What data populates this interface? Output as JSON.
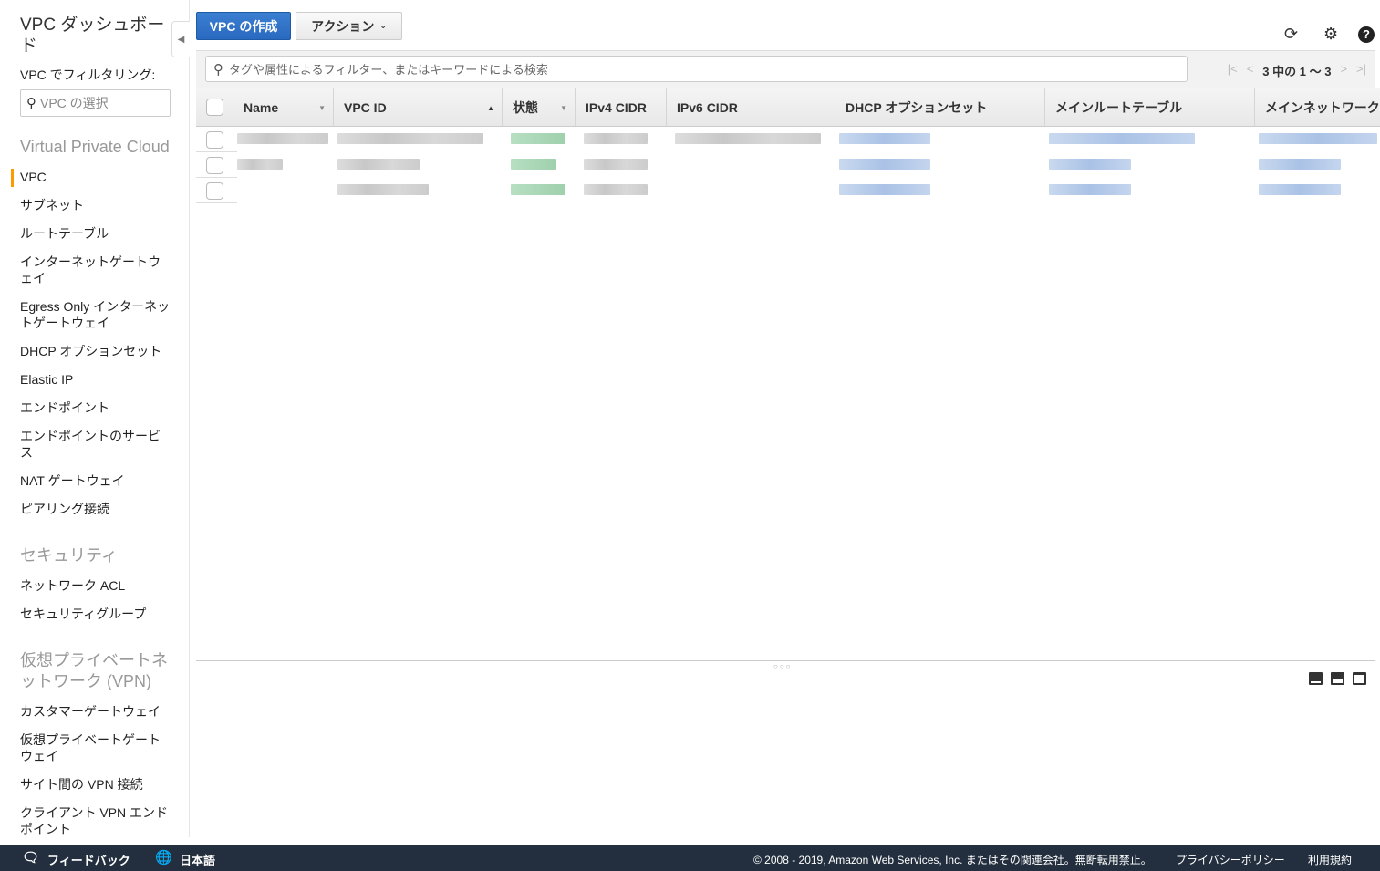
{
  "sidebar": {
    "title": "VPC ダッシュボード",
    "filter_label": "VPC でフィルタリング:",
    "filter_placeholder": "VPC の選択",
    "sections": [
      {
        "heading": "Virtual Private Cloud",
        "items": [
          "VPC",
          "サブネット",
          "ルートテーブル",
          "インターネットゲートウェイ",
          "Egress Only インターネットゲートウェイ",
          "DHCP オプションセット",
          "Elastic IP",
          "エンドポイント",
          "エンドポイントのサービス",
          "NAT ゲートウェイ",
          "ピアリング接続"
        ]
      },
      {
        "heading": "セキュリティ",
        "items": [
          "ネットワーク ACL",
          "セキュリティグループ"
        ]
      },
      {
        "heading": "仮想プライベートネットワーク (VPN)",
        "items": [
          "カスタマーゲートウェイ",
          "仮想プライベートゲートウェイ",
          "サイト間の VPN 接続",
          "クライアント VPN エンドポイント"
        ]
      }
    ],
    "active": "VPC"
  },
  "toolbar": {
    "create_label": "VPC の作成",
    "actions_label": "アクション"
  },
  "filter": {
    "placeholder": "タグや属性によるフィルター、またはキーワードによる検索"
  },
  "pager": {
    "label": "3 中の 1 〜 3"
  },
  "table": {
    "columns": [
      "Name",
      "VPC ID",
      "状態",
      "IPv4 CIDR",
      "IPv6 CIDR",
      "DHCP オプションセット",
      "メインルートテーブル",
      "メインネットワーク ACL"
    ],
    "row_count": 3
  },
  "footer": {
    "feedback": "フィードバック",
    "language": "日本語",
    "copyright": "© 2008 - 2019, Amazon Web Services, Inc. またはその関連会社。無断転用禁止。",
    "privacy": "プライバシーポリシー",
    "terms": "利用規約"
  }
}
